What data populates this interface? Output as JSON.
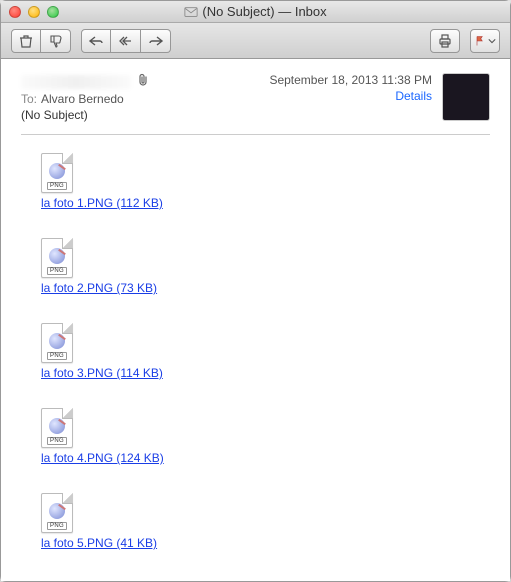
{
  "window": {
    "title": "(No Subject) — Inbox"
  },
  "header": {
    "to_label": "To:",
    "to_value": "Alvaro Bernedo",
    "subject": "(No Subject)",
    "date": "September 18, 2013 11:38 PM",
    "details_label": "Details"
  },
  "attachments": [
    {
      "name": "la foto 1.PNG (112 KB)",
      "badge": "PNG"
    },
    {
      "name": "la foto 2.PNG (73 KB)",
      "badge": "PNG"
    },
    {
      "name": "la foto 3.PNG (114 KB)",
      "badge": "PNG"
    },
    {
      "name": "la foto 4.PNG (124 KB)",
      "badge": "PNG"
    },
    {
      "name": "la foto 5.PNG (41 KB)",
      "badge": "PNG"
    }
  ]
}
